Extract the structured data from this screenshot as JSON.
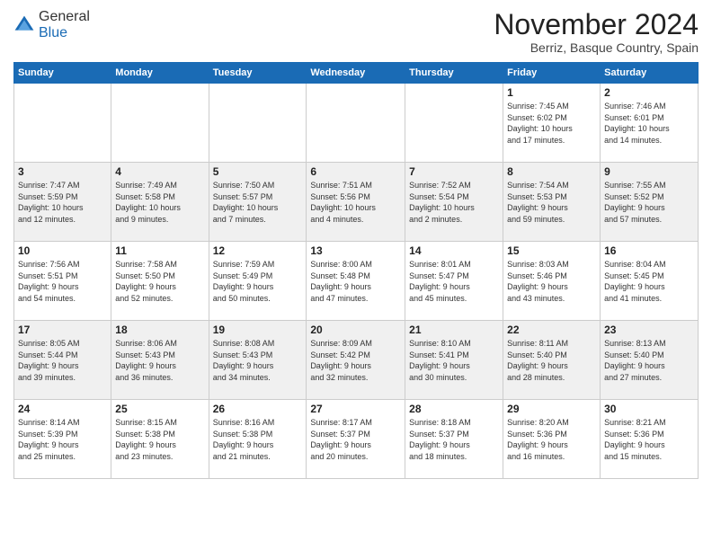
{
  "logo": {
    "general": "General",
    "blue": "Blue"
  },
  "title": "November 2024",
  "location": "Berriz, Basque Country, Spain",
  "days_header": [
    "Sunday",
    "Monday",
    "Tuesday",
    "Wednesday",
    "Thursday",
    "Friday",
    "Saturday"
  ],
  "weeks": [
    [
      {
        "day": "",
        "info": ""
      },
      {
        "day": "",
        "info": ""
      },
      {
        "day": "",
        "info": ""
      },
      {
        "day": "",
        "info": ""
      },
      {
        "day": "",
        "info": ""
      },
      {
        "day": "1",
        "info": "Sunrise: 7:45 AM\nSunset: 6:02 PM\nDaylight: 10 hours\nand 17 minutes."
      },
      {
        "day": "2",
        "info": "Sunrise: 7:46 AM\nSunset: 6:01 PM\nDaylight: 10 hours\nand 14 minutes."
      }
    ],
    [
      {
        "day": "3",
        "info": "Sunrise: 7:47 AM\nSunset: 5:59 PM\nDaylight: 10 hours\nand 12 minutes."
      },
      {
        "day": "4",
        "info": "Sunrise: 7:49 AM\nSunset: 5:58 PM\nDaylight: 10 hours\nand 9 minutes."
      },
      {
        "day": "5",
        "info": "Sunrise: 7:50 AM\nSunset: 5:57 PM\nDaylight: 10 hours\nand 7 minutes."
      },
      {
        "day": "6",
        "info": "Sunrise: 7:51 AM\nSunset: 5:56 PM\nDaylight: 10 hours\nand 4 minutes."
      },
      {
        "day": "7",
        "info": "Sunrise: 7:52 AM\nSunset: 5:54 PM\nDaylight: 10 hours\nand 2 minutes."
      },
      {
        "day": "8",
        "info": "Sunrise: 7:54 AM\nSunset: 5:53 PM\nDaylight: 9 hours\nand 59 minutes."
      },
      {
        "day": "9",
        "info": "Sunrise: 7:55 AM\nSunset: 5:52 PM\nDaylight: 9 hours\nand 57 minutes."
      }
    ],
    [
      {
        "day": "10",
        "info": "Sunrise: 7:56 AM\nSunset: 5:51 PM\nDaylight: 9 hours\nand 54 minutes."
      },
      {
        "day": "11",
        "info": "Sunrise: 7:58 AM\nSunset: 5:50 PM\nDaylight: 9 hours\nand 52 minutes."
      },
      {
        "day": "12",
        "info": "Sunrise: 7:59 AM\nSunset: 5:49 PM\nDaylight: 9 hours\nand 50 minutes."
      },
      {
        "day": "13",
        "info": "Sunrise: 8:00 AM\nSunset: 5:48 PM\nDaylight: 9 hours\nand 47 minutes."
      },
      {
        "day": "14",
        "info": "Sunrise: 8:01 AM\nSunset: 5:47 PM\nDaylight: 9 hours\nand 45 minutes."
      },
      {
        "day": "15",
        "info": "Sunrise: 8:03 AM\nSunset: 5:46 PM\nDaylight: 9 hours\nand 43 minutes."
      },
      {
        "day": "16",
        "info": "Sunrise: 8:04 AM\nSunset: 5:45 PM\nDaylight: 9 hours\nand 41 minutes."
      }
    ],
    [
      {
        "day": "17",
        "info": "Sunrise: 8:05 AM\nSunset: 5:44 PM\nDaylight: 9 hours\nand 39 minutes."
      },
      {
        "day": "18",
        "info": "Sunrise: 8:06 AM\nSunset: 5:43 PM\nDaylight: 9 hours\nand 36 minutes."
      },
      {
        "day": "19",
        "info": "Sunrise: 8:08 AM\nSunset: 5:43 PM\nDaylight: 9 hours\nand 34 minutes."
      },
      {
        "day": "20",
        "info": "Sunrise: 8:09 AM\nSunset: 5:42 PM\nDaylight: 9 hours\nand 32 minutes."
      },
      {
        "day": "21",
        "info": "Sunrise: 8:10 AM\nSunset: 5:41 PM\nDaylight: 9 hours\nand 30 minutes."
      },
      {
        "day": "22",
        "info": "Sunrise: 8:11 AM\nSunset: 5:40 PM\nDaylight: 9 hours\nand 28 minutes."
      },
      {
        "day": "23",
        "info": "Sunrise: 8:13 AM\nSunset: 5:40 PM\nDaylight: 9 hours\nand 27 minutes."
      }
    ],
    [
      {
        "day": "24",
        "info": "Sunrise: 8:14 AM\nSunset: 5:39 PM\nDaylight: 9 hours\nand 25 minutes."
      },
      {
        "day": "25",
        "info": "Sunrise: 8:15 AM\nSunset: 5:38 PM\nDaylight: 9 hours\nand 23 minutes."
      },
      {
        "day": "26",
        "info": "Sunrise: 8:16 AM\nSunset: 5:38 PM\nDaylight: 9 hours\nand 21 minutes."
      },
      {
        "day": "27",
        "info": "Sunrise: 8:17 AM\nSunset: 5:37 PM\nDaylight: 9 hours\nand 20 minutes."
      },
      {
        "day": "28",
        "info": "Sunrise: 8:18 AM\nSunset: 5:37 PM\nDaylight: 9 hours\nand 18 minutes."
      },
      {
        "day": "29",
        "info": "Sunrise: 8:20 AM\nSunset: 5:36 PM\nDaylight: 9 hours\nand 16 minutes."
      },
      {
        "day": "30",
        "info": "Sunrise: 8:21 AM\nSunset: 5:36 PM\nDaylight: 9 hours\nand 15 minutes."
      }
    ]
  ]
}
